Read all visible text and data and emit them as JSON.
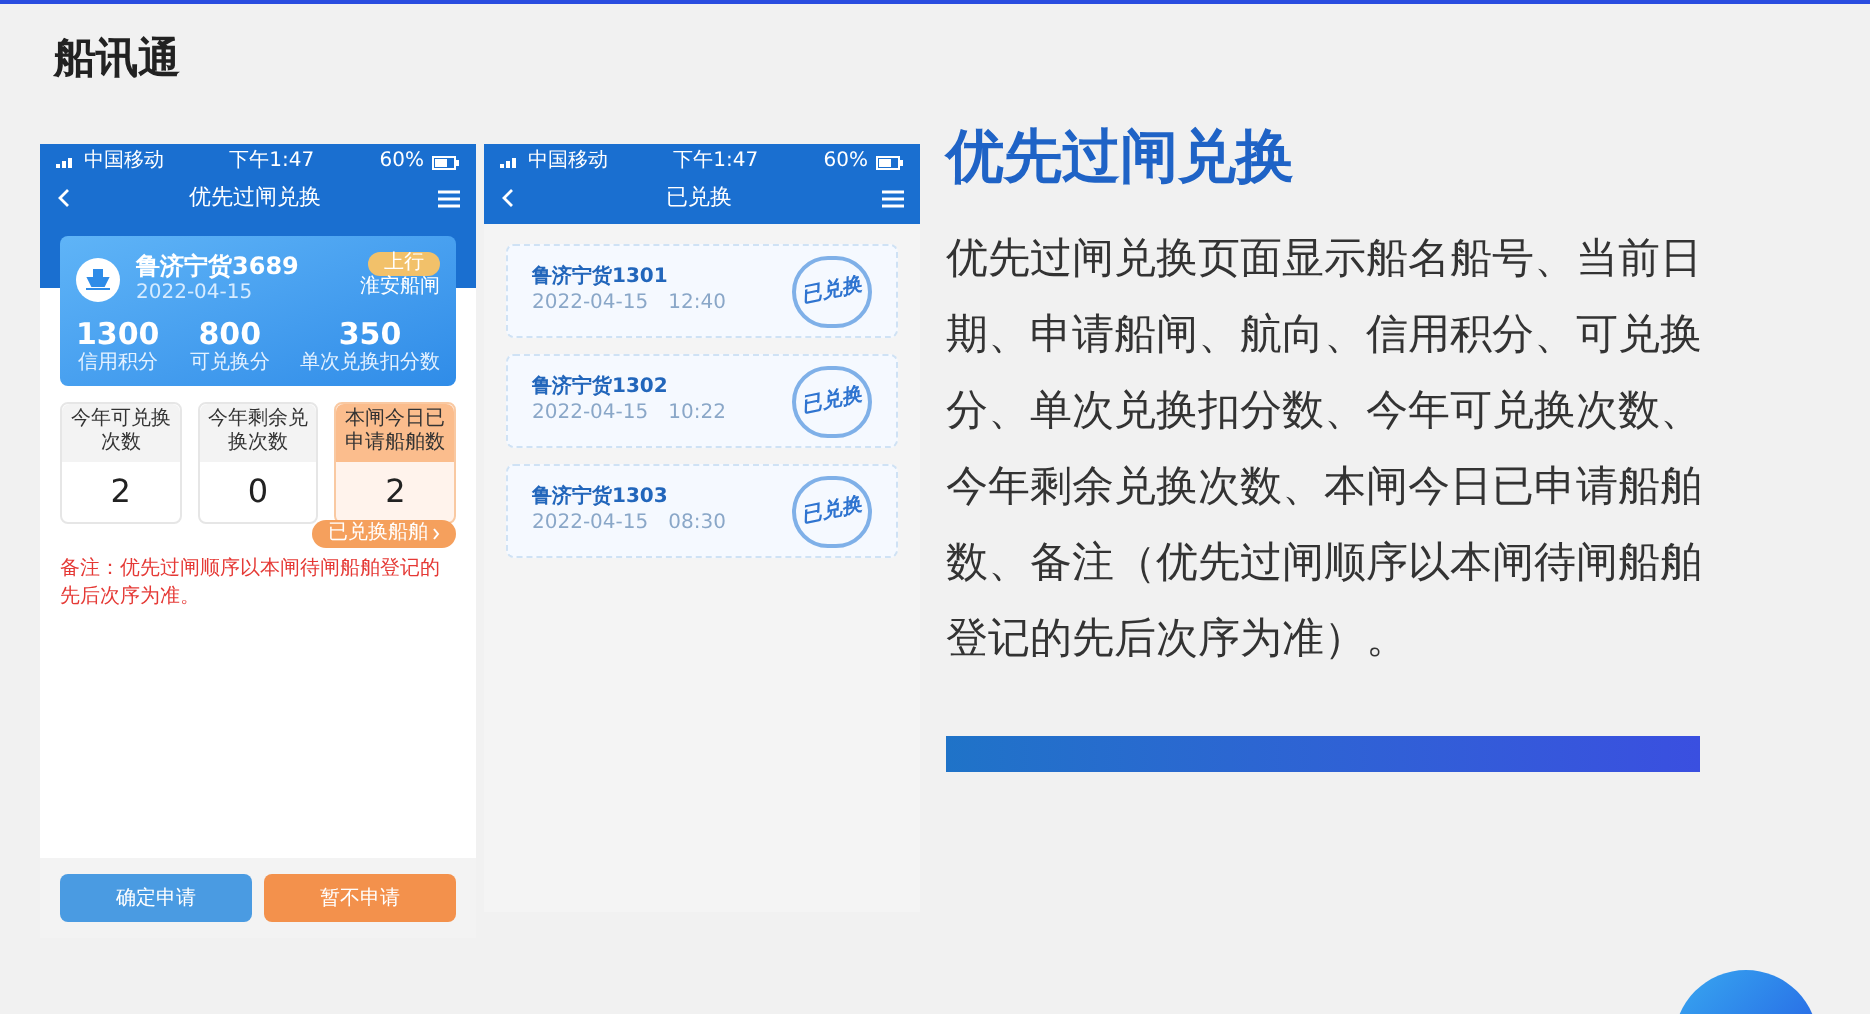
{
  "brand": "船讯通",
  "apply_screen": {
    "status_bar": {
      "carrier": "中国移动",
      "time": "下午1:47",
      "battery": "60%"
    },
    "nav_title": "优先过闸兑换",
    "ship_card": {
      "name": "鲁济宁货3689",
      "date": "2022-04-15",
      "direction": "上行",
      "lock": "淮安船闸",
      "stats": [
        {
          "value": "1300",
          "label": "信用积分"
        },
        {
          "value": "800",
          "label": "可兑换分"
        },
        {
          "value": "350",
          "label": "单次兑换扣分数"
        }
      ]
    },
    "counters": [
      {
        "label": "今年可兑换次数",
        "value": "2",
        "highlighted": false
      },
      {
        "label": "今年剩余兑换次数",
        "value": "0",
        "highlighted": false
      },
      {
        "label": "本闸今日已申请船舶数",
        "value": "2",
        "highlighted": true
      }
    ],
    "exchanged_link": "已兑换船舶",
    "note": "备注：优先过闸顺序以本闸待闸船舶登记的先后次序为准。",
    "buttons": [
      {
        "label": "确定申请",
        "kind": "primary"
      },
      {
        "label": "暂不申请",
        "kind": "secondary"
      }
    ]
  },
  "exchanged_screen": {
    "status_bar": {
      "carrier": "中国移动",
      "time": "下午1:47",
      "battery": "60%"
    },
    "nav_title": "已兑换",
    "records": [
      {
        "name": "鲁济宁货1301",
        "time": "2022-04-15　12:40",
        "stamp": "已兑换"
      },
      {
        "name": "鲁济宁货1302",
        "time": "2022-04-15　10:22",
        "stamp": "已兑换"
      },
      {
        "name": "鲁济宁货1303",
        "time": "2022-04-15　08:30",
        "stamp": "已兑换"
      }
    ]
  },
  "description": {
    "title": "优先过闸兑换",
    "body": "优先过闸兑换页面显示船名船号、当前日期、申请船闸、航向、信用积分、可兑换分、单次兑换扣分数、今年可兑换次数、今年剩余兑换次数、本闸今日已申请船舶数、备注（优先过闸顺序以本闸待闸船舶登记的先后次序为准）。"
  }
}
